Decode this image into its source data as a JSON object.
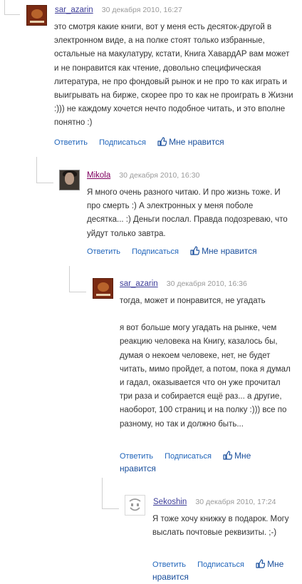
{
  "comments": [
    {
      "author": "sar_azarin",
      "date": "30 декабря 2010, 16:27",
      "text": "это смотря какие книги, вот у меня есть десяток-другой в электронном виде, а на полке стоят только избранные, остальные на макулатуру, кстати, Книга ХавардАР вам может и не понравится как чтение, довольно специфическая литература, не про фондовый рынок и не про то как играть и выигрывать на бирже, скорее про то как не проиграть в Жизни :))) не каждому хочется нечто подобное читать, и это вполне понятно :)",
      "reply_label": "Ответить",
      "subscribe_label": "Подписаться",
      "like_label": "Мне нравится"
    },
    {
      "author": "Mikola",
      "date": "30 декабря 2010, 16:30",
      "text": "Я много очень разного читаю. И про жизнь тоже. И про смерть :) А электронных у меня поболе десятка... :) Деньги послал. Правда подозреваю, что уйдут только завтра.",
      "reply_label": "Ответить",
      "subscribe_label": "Подписаться",
      "like_label": "Мне нравится"
    },
    {
      "author": "sar_azarin",
      "date": "30 декабря 2010, 16:36",
      "text_paragraphs": [
        "тогда, может и понравится, не угадать",
        "я вот больше могу угадать на рынке, чем реакцию человека на Книгу, казалось бы, думая о некоем человеке, нет, не будет читать, мимо пройдет, а потом, пока я думал и гадал, оказывается что он уже прочитал три раза и собирается ещё раз... а другие, наоборот, 100 страниц и на полку :))) все по разному, но так и должно быть..."
      ],
      "reply_label": "Ответить",
      "subscribe_label": "Подписаться",
      "like_label": "Мне нравится"
    },
    {
      "author": "Sekoshin",
      "date": "30 декабря 2010, 17:24",
      "text": "Я тоже хочу книжку в подарок. Могу выслать почтовые реквизиты. ;-)",
      "reply_label": "Ответить",
      "subscribe_label": "Подписаться",
      "like_label": "Мне нравится"
    }
  ]
}
